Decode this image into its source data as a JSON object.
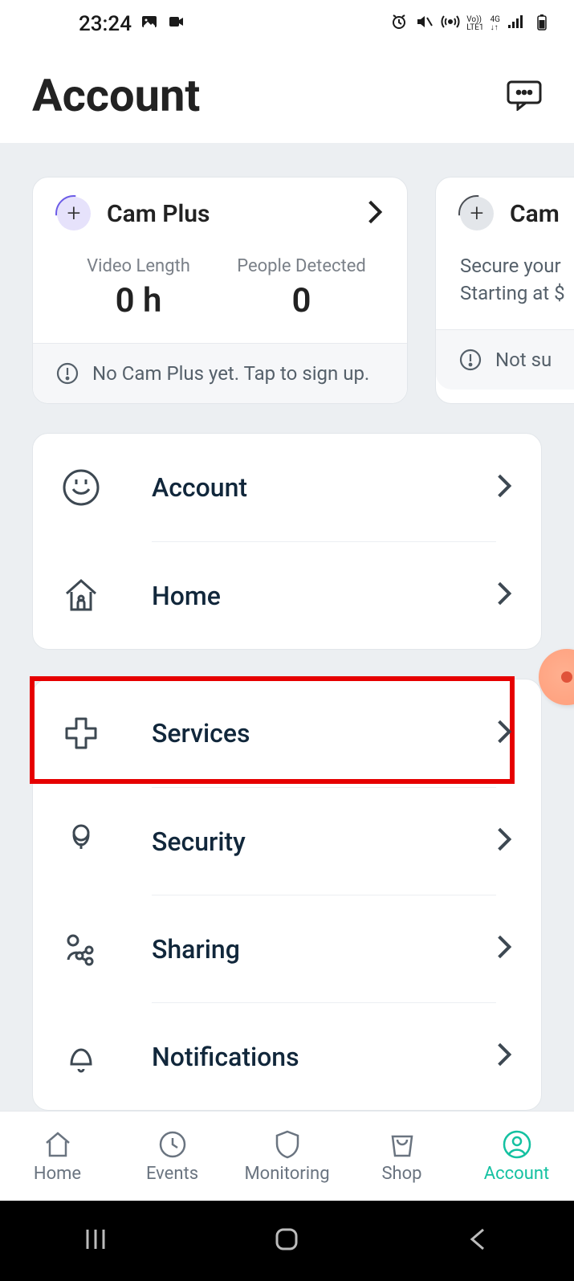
{
  "status": {
    "time": "23:24"
  },
  "header": {
    "title": "Account"
  },
  "promo": [
    {
      "title": "Cam Plus",
      "stat1_label": "Video Length",
      "stat1_value": "0 h",
      "stat2_label": "People Detected",
      "stat2_value": "0",
      "footer": "No Cam Plus yet. Tap to sign up."
    },
    {
      "title": "Cam",
      "desc": "Secure your",
      "desc2": "Starting at $",
      "footer": "Not su"
    }
  ],
  "menu_group1": [
    {
      "label": "Account"
    },
    {
      "label": "Home"
    }
  ],
  "menu_group2": [
    {
      "label": "Services"
    },
    {
      "label": "Security"
    },
    {
      "label": "Sharing"
    },
    {
      "label": "Notifications"
    }
  ],
  "tabs": [
    {
      "label": "Home"
    },
    {
      "label": "Events"
    },
    {
      "label": "Monitoring"
    },
    {
      "label": "Shop"
    },
    {
      "label": "Account"
    }
  ]
}
